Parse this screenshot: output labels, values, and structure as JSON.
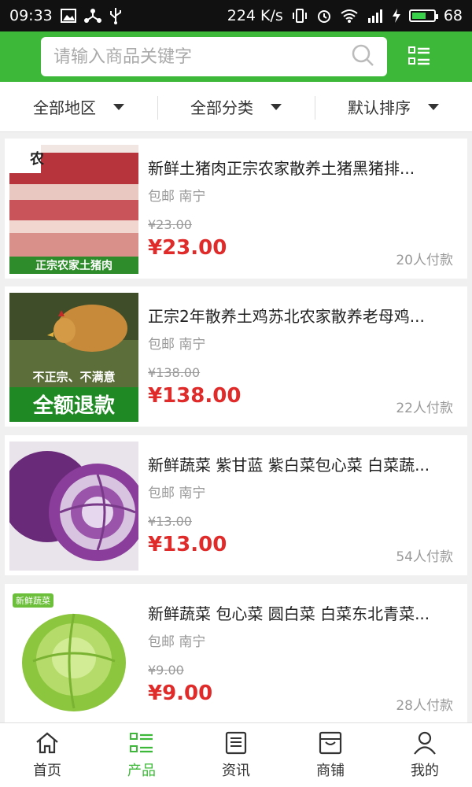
{
  "status_bar": {
    "time": "09:33",
    "speed": "224 K/s",
    "battery": "68",
    "battery_level": 0.68
  },
  "search": {
    "placeholder": "请输入商品关键字"
  },
  "filters": [
    {
      "label": "全部地区"
    },
    {
      "label": "全部分类"
    },
    {
      "label": "默认排序"
    }
  ],
  "products": [
    {
      "title": "新鲜土猪肉正宗农家散养土猪黑猪排...",
      "sub": "包邮 南宁",
      "old_price": "¥23.00",
      "price": "¥23.00",
      "sold": "20人付款",
      "thumb_text": "正宗农家土猪肉"
    },
    {
      "title": "正宗2年散养土鸡苏北农家散养老母鸡...",
      "sub": "包邮 南宁",
      "old_price": "¥138.00",
      "price": "¥138.00",
      "sold": "22人付款",
      "thumb_text": "不正宗、不满意",
      "thumb_text2": "全额退款"
    },
    {
      "title": "新鲜蔬菜 紫甘蓝 紫白菜包心菜 白菜蔬...",
      "sub": "包邮 南宁",
      "old_price": "¥13.00",
      "price": "¥13.00",
      "sold": "54人付款"
    },
    {
      "title": "新鲜蔬菜 包心菜 圆白菜 白菜东北青菜...",
      "sub": "包邮 南宁",
      "old_price": "¥9.00",
      "price": "¥9.00",
      "sold": "28人付款",
      "thumb_text": "新鲜蔬菜"
    }
  ],
  "nav": [
    {
      "label": "首页",
      "icon": "home-icon"
    },
    {
      "label": "产品",
      "icon": "product-icon"
    },
    {
      "label": "资讯",
      "icon": "news-icon"
    },
    {
      "label": "商铺",
      "icon": "shop-icon"
    },
    {
      "label": "我的",
      "icon": "user-icon"
    }
  ],
  "colors": {
    "brand_green": "#3db838",
    "price_red": "#e02b2b"
  }
}
